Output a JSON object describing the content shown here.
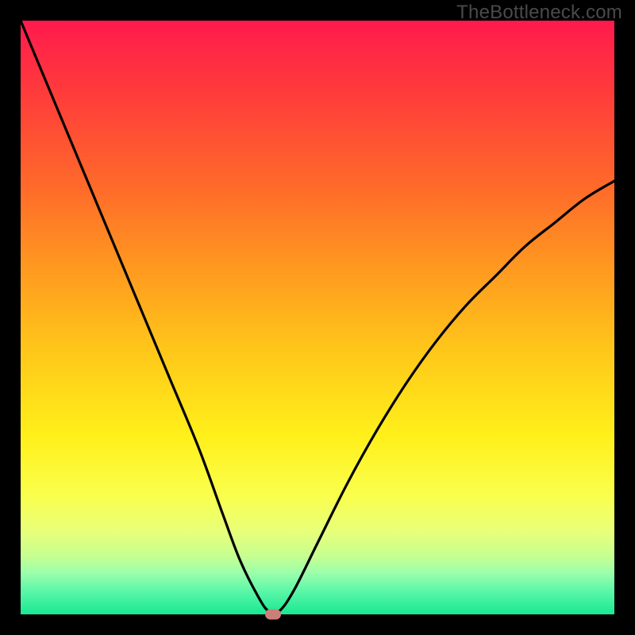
{
  "watermark": "TheBottleneck.com",
  "colors": {
    "frame": "#000000",
    "curve": "#000000",
    "marker": "#cc7f78"
  },
  "chart_data": {
    "type": "line",
    "title": "",
    "xlabel": "",
    "ylabel": "",
    "xlim": [
      0,
      100
    ],
    "ylim": [
      0,
      100
    ],
    "grid": false,
    "legend": false,
    "series": [
      {
        "name": "bottleneck-curve",
        "x": [
          0,
          5,
          10,
          15,
          20,
          25,
          30,
          34,
          37,
          40,
          41.8,
          43.5,
          46,
          50,
          55,
          60,
          65,
          70,
          75,
          80,
          85,
          90,
          95,
          100
        ],
        "y": [
          100,
          88,
          76,
          64,
          52,
          40,
          28,
          17,
          9,
          3,
          0.5,
          0.5,
          4,
          12,
          22,
          31,
          39,
          46,
          52,
          57,
          62,
          66,
          70,
          73
        ]
      }
    ],
    "marker": {
      "x": 42.5,
      "y": 0,
      "shape": "pill"
    },
    "background_gradient": [
      "#ff1a4d",
      "#ff9a1f",
      "#fff01a",
      "#18e892"
    ]
  }
}
